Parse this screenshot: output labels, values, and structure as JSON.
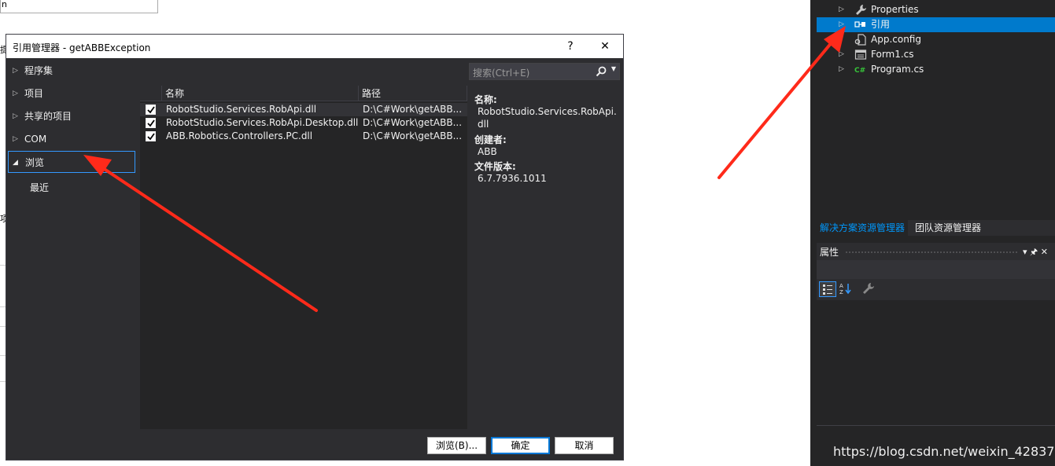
{
  "background": {
    "box_text": "n",
    "side_chars": [
      "提",
      "项"
    ]
  },
  "dialog": {
    "title": "引用管理器 - getABBException",
    "help_label": "?",
    "close_label": "✕",
    "nav": {
      "assemblies": "程序集",
      "projects": "项目",
      "shared_projects": "共享的项目",
      "com": "COM",
      "browse": "浏览",
      "recent": "最近"
    },
    "search": {
      "placeholder": "搜索(Ctrl+E)"
    },
    "columns": {
      "name": "名称",
      "path": "路径"
    },
    "rows": [
      {
        "name": "RobotStudio.Services.RobApi.dll",
        "path": "D:\\C#Work\\getABB...",
        "checked": true
      },
      {
        "name": "RobotStudio.Services.RobApi.Desktop.dll",
        "path": "D:\\C#Work\\getABB...",
        "checked": true
      },
      {
        "name": "ABB.Robotics.Controllers.PC.dll",
        "path": "D:\\C#Work\\getABB...",
        "checked": true
      }
    ],
    "details": {
      "name_label": "名称:",
      "name_line1": "RobotStudio.Services.RobApi.",
      "name_line2": "dll",
      "creator_label": "创建者:",
      "creator_value": "ABB",
      "version_label": "文件版本:",
      "version_value": "6.7.7936.1011"
    },
    "buttons": {
      "browse": "浏览(B)...",
      "ok": "确定",
      "cancel": "取消"
    }
  },
  "solution_explorer": {
    "items": [
      {
        "label": "Properties",
        "icon": "wrench-icon"
      },
      {
        "label": "引用",
        "icon": "references-icon"
      },
      {
        "label": "App.config",
        "icon": "config-file-icon"
      },
      {
        "label": "Form1.cs",
        "icon": "form-icon"
      },
      {
        "label": "Program.cs",
        "icon": "csharp-file-icon"
      }
    ],
    "tabs": {
      "active": "解决方案资源管理器",
      "inactive": "团队资源管理器"
    }
  },
  "properties": {
    "title": "属性",
    "pin_label": "▾ 🖈 ✕"
  },
  "watermark": "https://blog.csdn.net/weixin_42837024",
  "colors": {
    "dialog_bg": "#2d2d30",
    "panel_bg": "#252526",
    "accent": "#007acc",
    "annotation_arrow": "#ff2a1a"
  }
}
